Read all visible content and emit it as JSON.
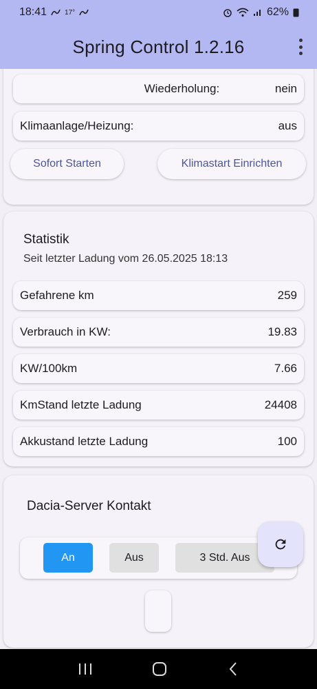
{
  "status": {
    "time": "18:41",
    "temp": "17°",
    "battery": "62%"
  },
  "app": {
    "title": "Spring Control 1.2.16"
  },
  "control": {
    "rows": [
      {
        "label": "Wiederholung:",
        "value": "nein"
      },
      {
        "label": "Klimaanlage/Heizung:",
        "value": "aus"
      }
    ],
    "buttons": {
      "start": "Sofort Starten",
      "setup": "Klimastart Einrichten"
    }
  },
  "stats": {
    "title": "Statistik",
    "subtitle": "Seit letzter Ladung vom 26.05.2025 18:13",
    "rows": [
      {
        "label": "Gefahrene km",
        "value": "259"
      },
      {
        "label": "Verbrauch in KW:",
        "value": "19.83"
      },
      {
        "label": "KW/100km",
        "value": "7.66"
      },
      {
        "label": "KmStand letzte Ladung",
        "value": "24408"
      },
      {
        "label": "Akkustand letzte Ladung",
        "value": "100"
      }
    ]
  },
  "server": {
    "title": "Dacia-Server Kontakt",
    "segments": [
      "An",
      "Aus",
      "3 Std. Aus"
    ],
    "selected": "An"
  },
  "colors": {
    "appbar": "#b3b8f3",
    "accent": "#2196f3",
    "link": "#4a56a0"
  }
}
